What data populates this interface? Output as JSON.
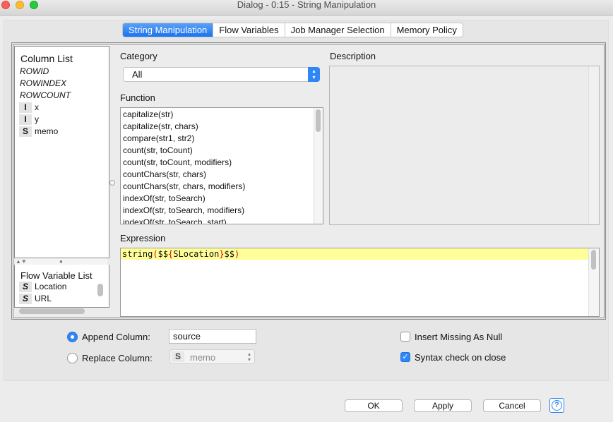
{
  "window": {
    "title": "Dialog - 0:15 - String Manipulation"
  },
  "tabs": [
    {
      "label": "String Manipulation",
      "active": true
    },
    {
      "label": "Flow Variables"
    },
    {
      "label": "Job Manager Selection"
    },
    {
      "label": "Memory Policy"
    }
  ],
  "column_list": {
    "title": "Column List",
    "special": [
      "ROWID",
      "ROWINDEX",
      "ROWCOUNT"
    ],
    "columns": [
      {
        "type": "I",
        "name": "x"
      },
      {
        "type": "I",
        "name": "y"
      },
      {
        "type": "S",
        "name": "memo"
      }
    ]
  },
  "flow_variable_list": {
    "title": "Flow Variable List",
    "items": [
      {
        "type": "S",
        "name": "Location"
      },
      {
        "type": "S",
        "name": "URL"
      }
    ]
  },
  "category": {
    "label": "Category",
    "value": "All"
  },
  "function": {
    "label": "Function",
    "items": [
      "capitalize(str)",
      "capitalize(str, chars)",
      "compare(str1, str2)",
      "count(str, toCount)",
      "count(str, toCount, modifiers)",
      "countChars(str, chars)",
      "countChars(str, chars, modifiers)",
      "indexOf(str, toSearch)",
      "indexOf(str, toSearch, modifiers)",
      "indexOf(str, toSearch, start)"
    ]
  },
  "description": {
    "label": "Description"
  },
  "expression": {
    "label": "Expression",
    "tokens": [
      {
        "t": "string",
        "red": false
      },
      {
        "t": "(",
        "red": true
      },
      {
        "t": "$$",
        "red": false
      },
      {
        "t": "{",
        "red": true
      },
      {
        "t": "SLocation",
        "red": false
      },
      {
        "t": "}",
        "red": true
      },
      {
        "t": "$$",
        "red": false
      },
      {
        "t": ")",
        "red": true
      }
    ],
    "highlight_color": "#ffff99"
  },
  "options": {
    "append_label": "Append Column:",
    "append_value": "source",
    "append_selected": true,
    "replace_label": "Replace Column:",
    "replace_type": "S",
    "replace_value": "memo",
    "insert_missing_label": "Insert Missing As Null",
    "insert_missing_checked": false,
    "syntax_check_label": "Syntax check on close",
    "syntax_check_checked": true
  },
  "buttons": {
    "ok": "OK",
    "apply": "Apply",
    "cancel": "Cancel",
    "help": "?"
  }
}
